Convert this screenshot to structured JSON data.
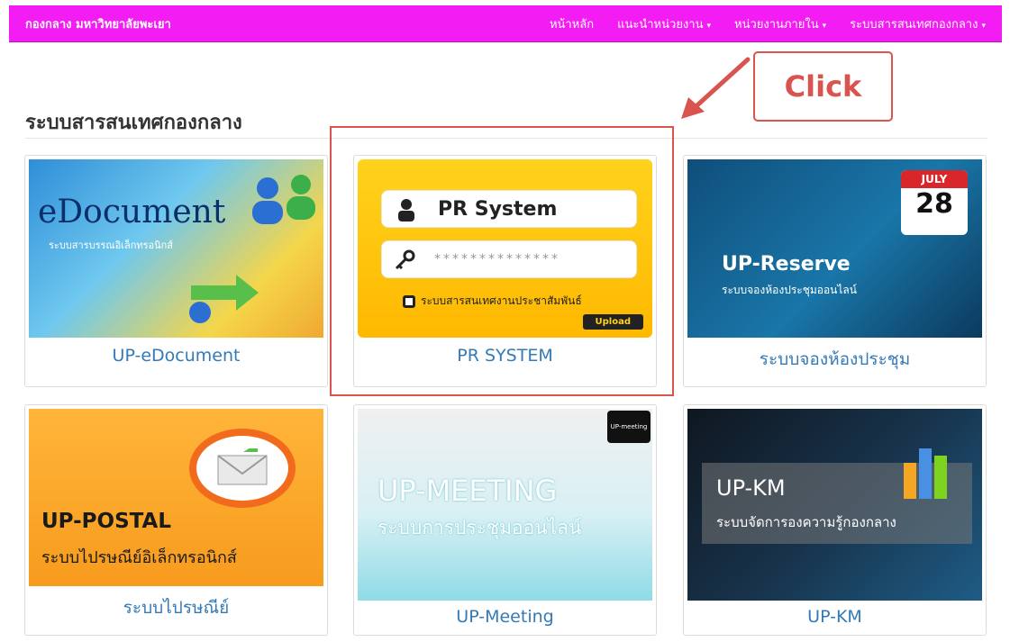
{
  "navbar": {
    "brand": "กองกลาง มหาวิทยาลัยพะเยา",
    "items": [
      {
        "label": "หน้าหลัก",
        "dropdown": false
      },
      {
        "label": "แนะนำหน่วยงาน",
        "dropdown": true
      },
      {
        "label": "หน่วยงานภายใน",
        "dropdown": true
      },
      {
        "label": "ระบบสารสนเทศกองกลาง",
        "dropdown": true
      }
    ],
    "caret": "▾"
  },
  "section": {
    "title": "ระบบสารสนเทศกองกลาง"
  },
  "cards": {
    "edoc": {
      "caption": "UP-eDocument",
      "thumb_title": "eDocument",
      "thumb_sub": "ระบบสารบรรณอิเล็กทรอนิกส์"
    },
    "pr": {
      "caption": "PR SYSTEM",
      "thumb_title": "PR  System",
      "thumb_password": "**************",
      "thumb_sub": "ระบบสารสนเทศงานประชาสัมพันธ์",
      "thumb_button": "Upload"
    },
    "reserve": {
      "caption": "ระบบจองห้องประชุม",
      "thumb_month": "JULY",
      "thumb_day": "28",
      "thumb_title": "UP-Reserve",
      "thumb_sub": "ระบบจองห้องประชุมออนไลน์"
    },
    "postal": {
      "caption": "ระบบไปรษณีย์",
      "thumb_title": "UP-POSTAL",
      "thumb_sub": "ระบบไปรษณีย์อิเล็กทรอนิกส์"
    },
    "meeting": {
      "caption": "UP-Meeting",
      "thumb_tag": "UP-meeting",
      "thumb_title": "UP-MEETING",
      "thumb_sub": "ระบบการประชุมออนไลน์"
    },
    "km": {
      "caption": "UP-KM",
      "thumb_title": "UP-KM",
      "thumb_sub": "ระบบจัดการองความรู้กองกลาง"
    }
  },
  "annotation": {
    "callout": "Click",
    "color": "#d9534f"
  },
  "colors": {
    "navbar": "#f31cf3",
    "link": "#337ab7",
    "pr_yellow": "#ffd21c"
  }
}
